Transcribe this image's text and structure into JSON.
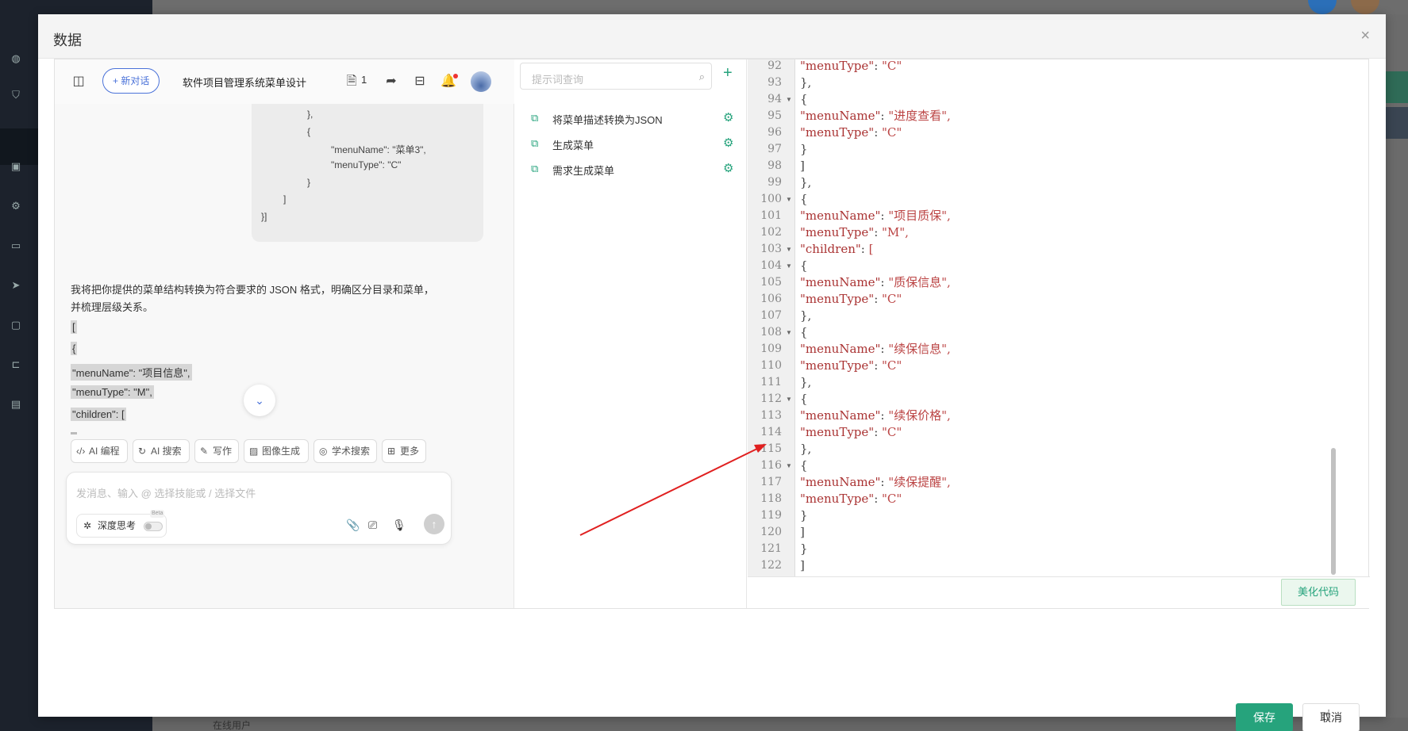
{
  "background": {
    "bottom_text": "在线用户"
  },
  "modal": {
    "title": "数据",
    "close": "×"
  },
  "chat": {
    "new_button": "+ 新对话",
    "title": "软件项目管理系统菜单设计",
    "doc_count": "1",
    "code_lines": [
      "},",
      "{",
      "\"menuName\": \"菜单3\",",
      "\"menuType\": \"C\"",
      "}",
      "]",
      "}]"
    ],
    "reply_line1": "我将把你提供的菜单结构转换为符合要求的 JSON 格式，明确区分目录和菜单，",
    "reply_line2": "并梳理层级关系。",
    "highlighted": [
      "[",
      "{",
      "\"menuName\": \"项目信息\",",
      "\"menuType\": \"M\",",
      "\"children\": ["
    ],
    "chips": [
      {
        "icon": "code-icon",
        "label": "AI 编程"
      },
      {
        "icon": "search-refresh-icon",
        "label": "AI 搜索"
      },
      {
        "icon": "pen-icon",
        "label": "写作"
      },
      {
        "icon": "image-icon",
        "label": "图像生成"
      },
      {
        "icon": "academic-icon",
        "label": "学术搜索"
      },
      {
        "icon": "grid-icon",
        "label": "更多"
      }
    ],
    "input_placeholder": "发消息、输入 @ 选择技能或 / 选择文件",
    "deep_think": "深度思考",
    "beta": "Beta"
  },
  "prompts": {
    "search_placeholder": "提示词查询",
    "items": [
      "将菜单描述转换为JSON",
      "生成菜单",
      "需求生成菜单"
    ]
  },
  "editor": {
    "lines": [
      {
        "n": "92",
        "fold": false,
        "text": "\"menuType\": \"C\""
      },
      {
        "n": "93",
        "fold": false,
        "text": "},"
      },
      {
        "n": "94",
        "fold": true,
        "text": "{"
      },
      {
        "n": "95",
        "fold": false,
        "text": "\"menuName\": \"进度查看\","
      },
      {
        "n": "96",
        "fold": false,
        "text": "\"menuType\": \"C\""
      },
      {
        "n": "97",
        "fold": false,
        "text": "}"
      },
      {
        "n": "98",
        "fold": false,
        "text": "]"
      },
      {
        "n": "99",
        "fold": false,
        "text": "},"
      },
      {
        "n": "100",
        "fold": true,
        "text": "{"
      },
      {
        "n": "101",
        "fold": false,
        "text": "\"menuName\": \"项目质保\","
      },
      {
        "n": "102",
        "fold": false,
        "text": "\"menuType\": \"M\","
      },
      {
        "n": "103",
        "fold": true,
        "text": "\"children\": ["
      },
      {
        "n": "104",
        "fold": true,
        "text": "{"
      },
      {
        "n": "105",
        "fold": false,
        "text": "\"menuName\": \"质保信息\","
      },
      {
        "n": "106",
        "fold": false,
        "text": "\"menuType\": \"C\""
      },
      {
        "n": "107",
        "fold": false,
        "text": "},"
      },
      {
        "n": "108",
        "fold": true,
        "text": "{"
      },
      {
        "n": "109",
        "fold": false,
        "text": "\"menuName\": \"续保信息\","
      },
      {
        "n": "110",
        "fold": false,
        "text": "\"menuType\": \"C\""
      },
      {
        "n": "111",
        "fold": false,
        "text": "},"
      },
      {
        "n": "112",
        "fold": true,
        "text": "{"
      },
      {
        "n": "113",
        "fold": false,
        "text": "\"menuName\": \"续保价格\","
      },
      {
        "n": "114",
        "fold": false,
        "text": "\"menuType\": \"C\""
      },
      {
        "n": "115",
        "fold": false,
        "text": "},"
      },
      {
        "n": "116",
        "fold": true,
        "text": "{"
      },
      {
        "n": "117",
        "fold": false,
        "text": "\"menuName\": \"续保提醒\","
      },
      {
        "n": "118",
        "fold": false,
        "text": "\"menuType\": \"C\""
      },
      {
        "n": "119",
        "fold": false,
        "text": "}"
      },
      {
        "n": "120",
        "fold": false,
        "text": "]"
      },
      {
        "n": "121",
        "fold": false,
        "text": "}"
      },
      {
        "n": "122",
        "fold": false,
        "text": "]"
      }
    ],
    "beautify_button": "美化代码"
  },
  "footer": {
    "save": "保存",
    "cancel": "取消"
  },
  "colors": {
    "accent": "#26a37c",
    "link_blue": "#4a72d9",
    "arrow": "#e02020"
  }
}
